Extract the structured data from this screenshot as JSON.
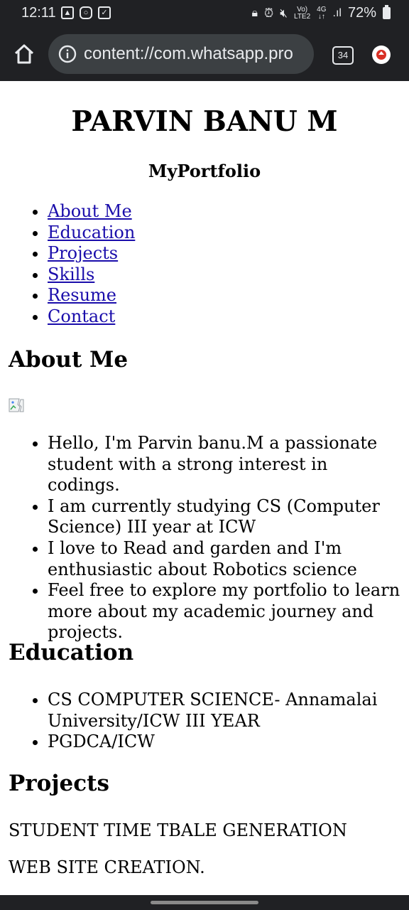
{
  "status_bar": {
    "time": "12:11",
    "battery": "72%",
    "network_top": "Vo)",
    "network_bottom": "LTE2",
    "network_type": "4G"
  },
  "browser": {
    "url": "content://com.whatsapp.pro",
    "tab_count": "34"
  },
  "page": {
    "title": "PARVIN BANU M",
    "subtitle": "MyPortfolio",
    "nav": [
      "About Me",
      "Education",
      "Projects",
      "Skills",
      "Resume",
      "Contact"
    ],
    "about": {
      "heading": "About Me",
      "items": [
        "Hello, I'm Parvin banu.M a passionate student with a strong interest in codings.",
        "I am currently studying CS (Computer Science) III year at ICW",
        "I love to Read and garden and I'm enthusiastic about Robotics science",
        "Feel free to explore my portfolio to learn more about my academic journey and projects."
      ]
    },
    "education": {
      "heading": "Education",
      "items": [
        "CS COMPUTER SCIENCE- Annamalai University/ICW III YEAR",
        "PGDCA/ICW"
      ]
    },
    "projects": {
      "heading": "Projects",
      "items": [
        "STUDENT TIME TBALE GENERATION",
        "WEB SITE CREATION."
      ]
    }
  }
}
